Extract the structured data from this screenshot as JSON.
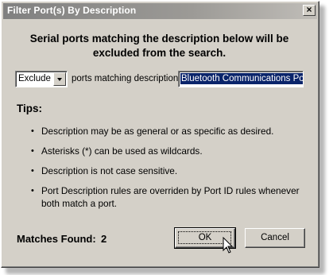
{
  "window": {
    "title": "Filter Port(s) By Description",
    "close_glyph": "×"
  },
  "heading": {
    "line1": "Serial ports matching the description below will be",
    "line2": "excluded from the search."
  },
  "filter": {
    "mode_value": "Exclude",
    "mode_options": [
      "Exclude"
    ],
    "label": "ports matching description:",
    "description_value": "Bluetooth Communications Port"
  },
  "tips": {
    "title": "Tips:",
    "bullet": "•",
    "items": [
      "Description may be as general or as specific as desired.",
      "Asterisks (*) can be used as wildcards.",
      "Description is not case sensitive.",
      "Port Description rules are overriden by Port ID rules whenever both match a port."
    ]
  },
  "matches": {
    "label": "Matches Found:",
    "count": "2"
  },
  "buttons": {
    "ok": "OK",
    "cancel": "Cancel"
  },
  "icons": {
    "cursor": "mouse-pointer-icon",
    "dropdown": "chevron-down-icon",
    "close": "close-icon"
  }
}
